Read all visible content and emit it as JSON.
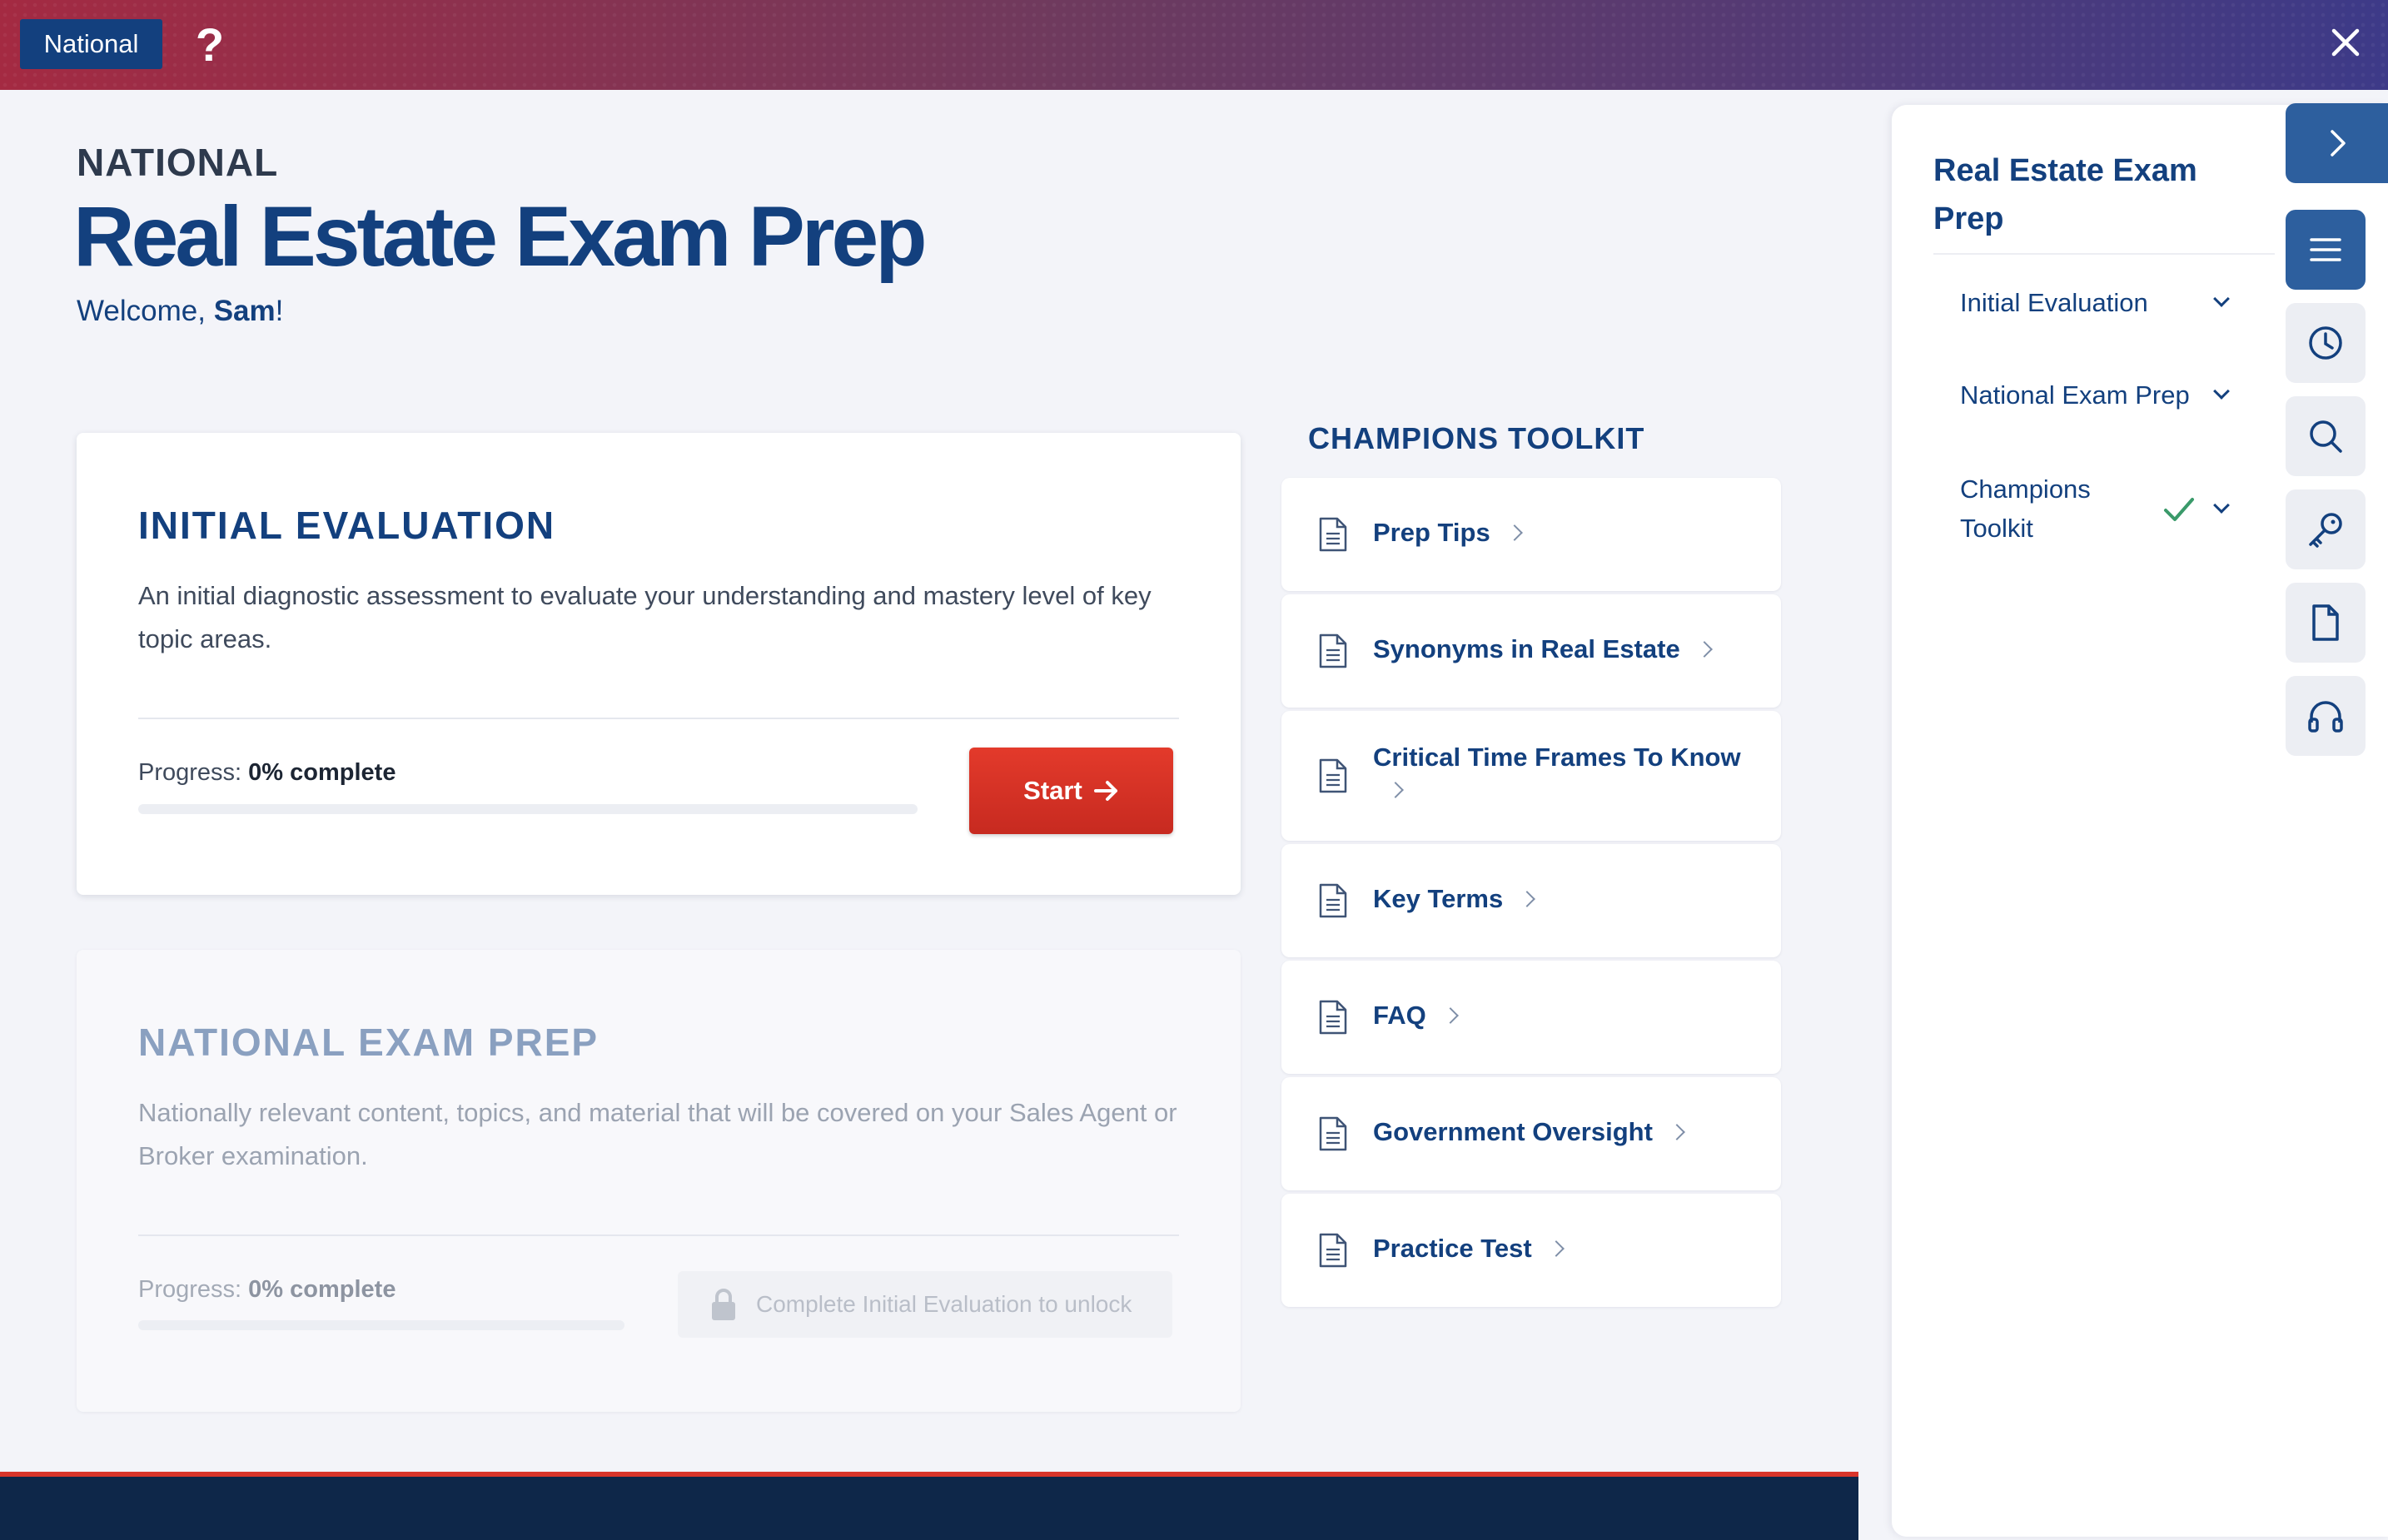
{
  "topbar": {
    "badge": "National",
    "help": "?"
  },
  "header": {
    "eyebrow": "NATIONAL",
    "title": "Real Estate Exam Prep",
    "welcome_prefix": "Welcome, ",
    "welcome_name": "Sam",
    "welcome_suffix": "!"
  },
  "cards": [
    {
      "title": "INITIAL EVALUATION",
      "description": "An initial diagnostic assessment to evaluate your understanding and mastery level of key topic areas.",
      "progress_prefix": "Progress: ",
      "progress_value": "0% complete",
      "progress_fraction": 0,
      "button": "Start"
    },
    {
      "title": "NATIONAL EXAM PREP",
      "description": "Nationally relevant content, topics, and material that will be covered on your Sales Agent or Broker examination.",
      "progress_prefix": "Progress: ",
      "progress_value": "0% complete",
      "progress_fraction": 0,
      "locked_text": "Complete Initial Evaluation to unlock"
    }
  ],
  "toolkit": {
    "heading": "CHAMPIONS TOOLKIT",
    "items": [
      {
        "label": "Prep Tips"
      },
      {
        "label": "Synonyms in Real Estate"
      },
      {
        "label": "Critical Time Frames To Know"
      },
      {
        "label": "Key Terms"
      },
      {
        "label": "FAQ"
      },
      {
        "label": "Government Oversight"
      },
      {
        "label": "Practice Test"
      }
    ]
  },
  "sidebar": {
    "title": "Real Estate Exam Prep",
    "items": [
      {
        "label": "Initial Evaluation"
      },
      {
        "label": "National Exam Prep"
      },
      {
        "label": "Champions Toolkit",
        "completed": true
      }
    ]
  },
  "rail_icons": [
    "chevron-right-icon",
    "menu-icon",
    "clock-icon",
    "search-icon",
    "key-icon",
    "document-icon",
    "headphones-icon"
  ],
  "colors": {
    "brand_navy": "#13407e",
    "accent_red": "#d8352a",
    "rail_active": "#2d5f9e",
    "footer": "#0e2749"
  }
}
